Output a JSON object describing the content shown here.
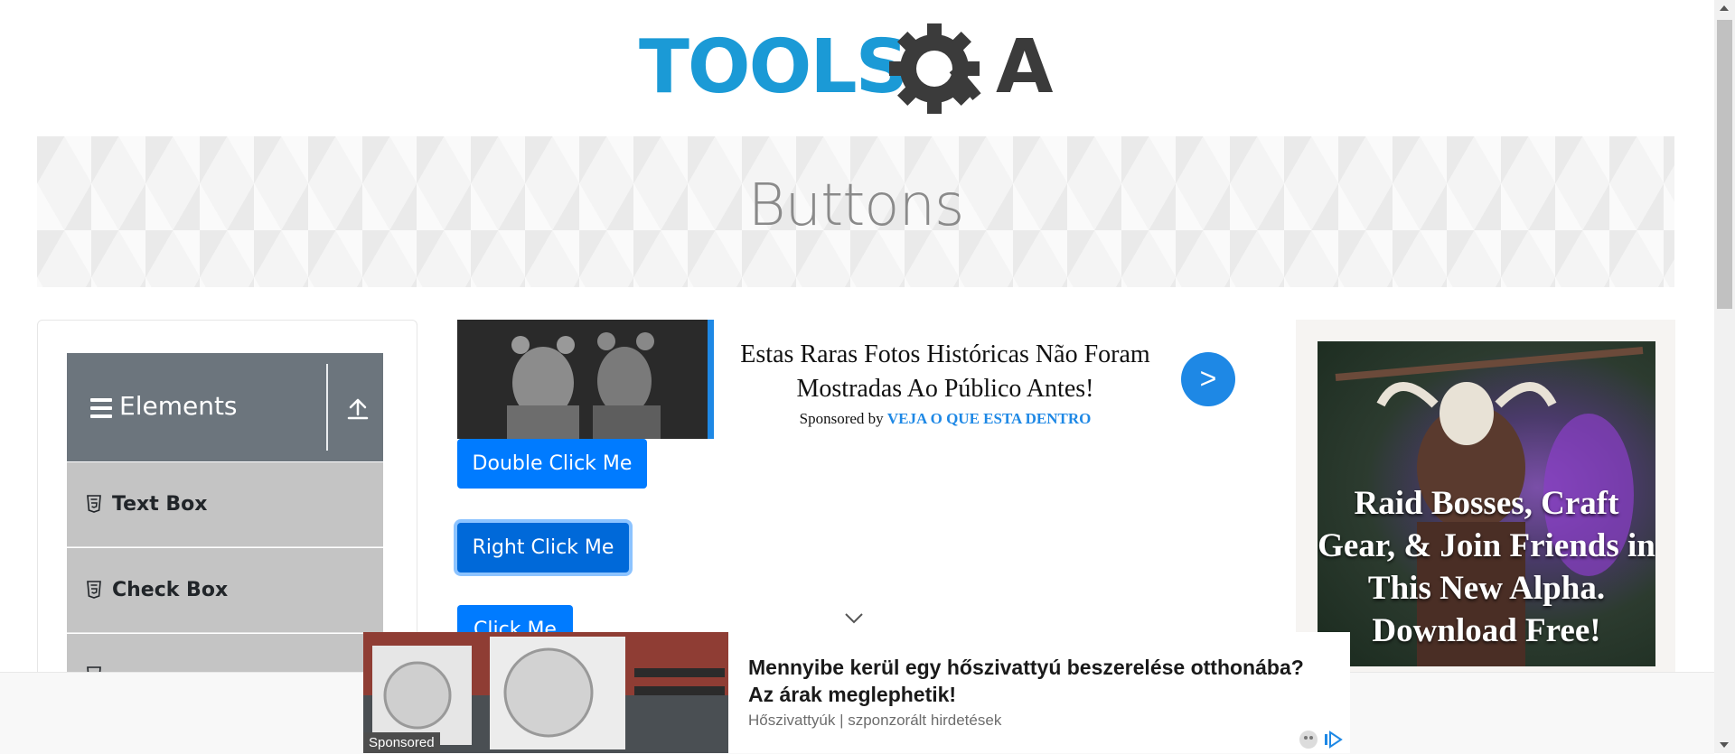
{
  "logo": {
    "text_tools": "TOOLS",
    "text_a": "A",
    "colors": {
      "tools": "#1b9ad6",
      "qa": "#3b3b3b"
    }
  },
  "banner": {
    "title": "Buttons"
  },
  "sidebar": {
    "group": {
      "title": "Elements",
      "icon": "hamburger-icon",
      "collapse_icon": "upload-icon"
    },
    "items": [
      {
        "label": "Text Box",
        "icon": "html5-icon"
      },
      {
        "label": "Check Box",
        "icon": "html5-icon"
      }
    ]
  },
  "ad_top": {
    "text": "Estas Raras Fotos Históricas Não Foram Mostradas Ao Público Antes!",
    "sponsored_prefix": "Sponsored by",
    "sponsor": "VEJA O QUE ESTA DENTRO",
    "arrow": ">"
  },
  "buttons": {
    "double_click": "Double Click Me",
    "right_click": "Right Click Me",
    "click": "Click Me"
  },
  "ad_right": {
    "headline": "Raid Bosses, Craft Gear, & Join Friends in This New Alpha. Download Free!"
  },
  "ad_bottom": {
    "headline": "Mennyibe kerül egy hőszivattyú beszerelése otthonába? Az árak meglephetik!",
    "source": "Hőszivattyúk | szponzorált hirdetések",
    "tag": "Sponsored"
  },
  "colors": {
    "primary": "#007bff",
    "primary_active": "#0069d9",
    "sidebar_header": "#6c757d",
    "sidebar_item": "#c4c4c4"
  }
}
